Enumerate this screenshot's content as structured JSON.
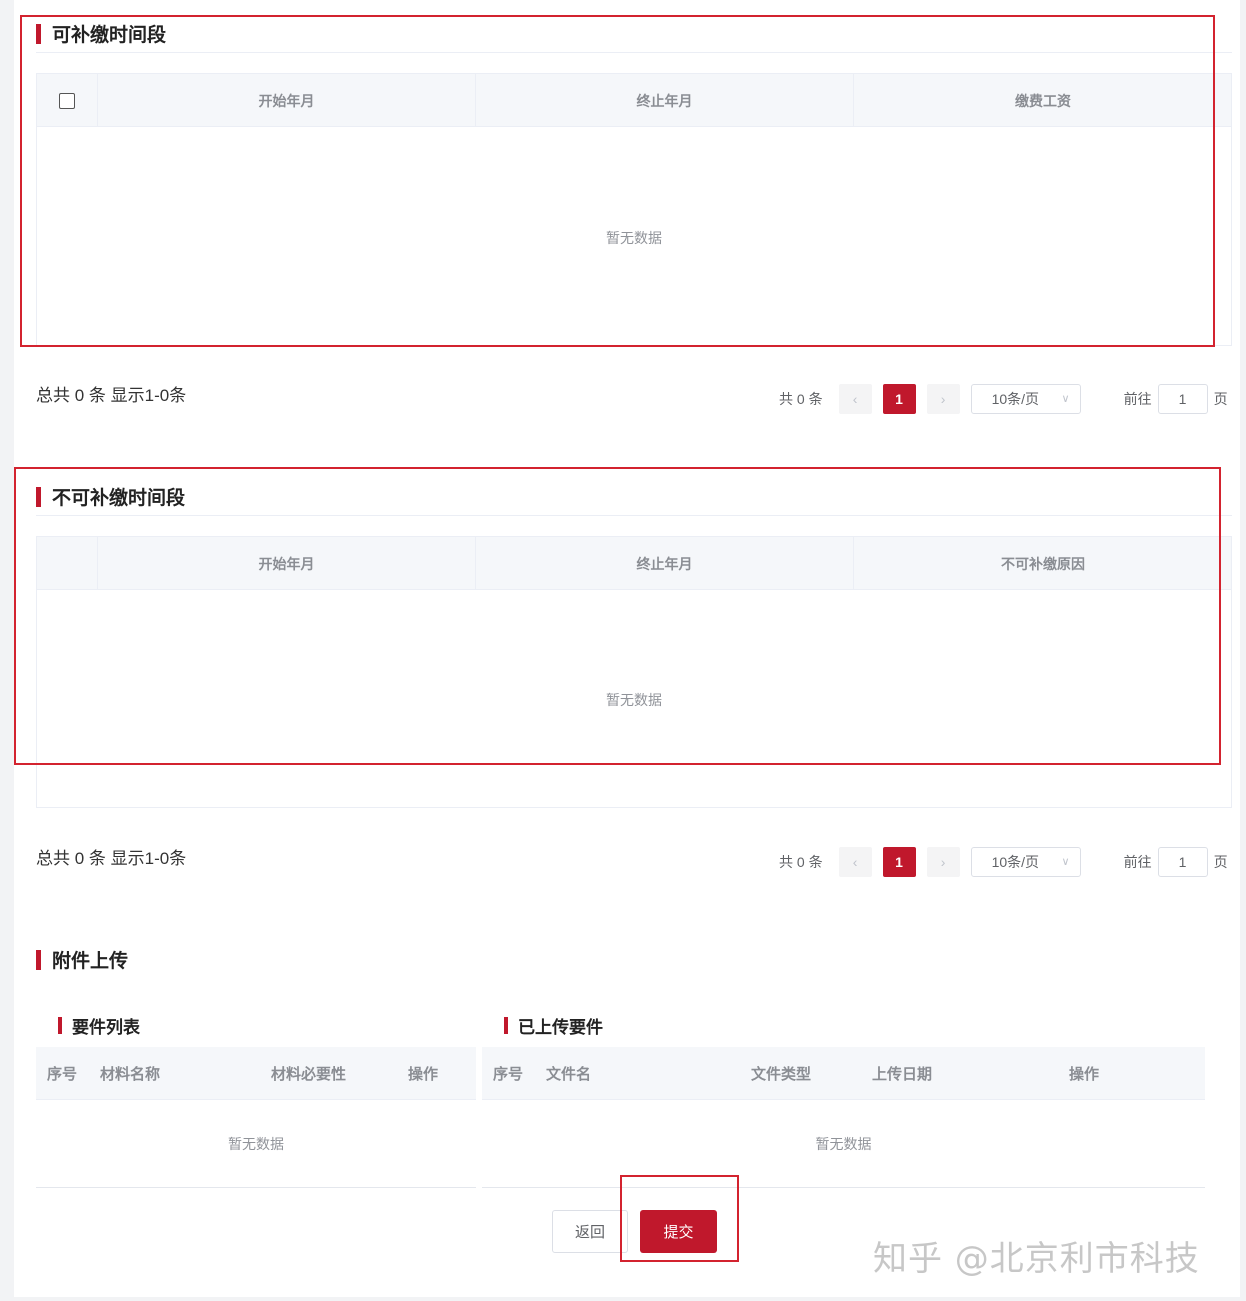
{
  "section1": {
    "title": "可补缴时间段",
    "columns": [
      "开始年月",
      "终止年月",
      "缴费工资"
    ],
    "empty_text": "暂无数据",
    "summary": "总共 0 条 显示1-0条",
    "pager": {
      "total": "共 0 条",
      "prev": "‹",
      "page": "1",
      "next": "›",
      "size": "10条/页",
      "goto_label": "前往",
      "goto_value": "1",
      "goto_unit": "页"
    }
  },
  "section2": {
    "title": "不可补缴时间段",
    "columns": [
      "开始年月",
      "终止年月",
      "不可补缴原因"
    ],
    "empty_text": "暂无数据",
    "summary": "总共 0 条 显示1-0条",
    "pager": {
      "total": "共 0 条",
      "prev": "‹",
      "page": "1",
      "next": "›",
      "size": "10条/页",
      "goto_label": "前往",
      "goto_value": "1",
      "goto_unit": "页"
    }
  },
  "attachments": {
    "title": "附件上传",
    "required": {
      "title": "要件列表",
      "columns": [
        "序号",
        "材料名称",
        "材料必要性",
        "操作"
      ],
      "empty_text": "暂无数据"
    },
    "uploaded": {
      "title": "已上传要件",
      "columns": [
        "序号",
        "文件名",
        "文件类型",
        "上传日期",
        "操作"
      ],
      "empty_text": "暂无数据"
    }
  },
  "actions": {
    "back": "返回",
    "submit": "提交"
  },
  "watermark": "知乎 @北京利市科技",
  "colors": {
    "accent": "#c0182c",
    "highlight_frame": "#d3232f"
  }
}
